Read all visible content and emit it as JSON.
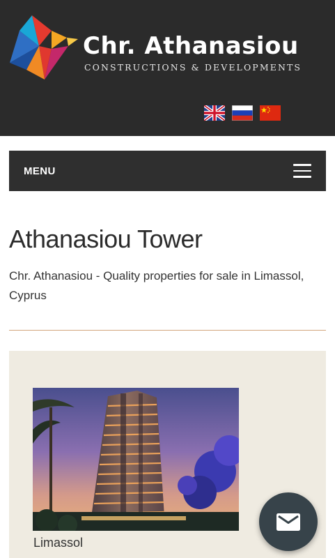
{
  "header": {
    "brand_name": "Chr. Athanasiou",
    "brand_tagline": "CONSTRUCTIONS & DEVELOPMENTS",
    "logo_icon": "bird-logo",
    "languages": [
      {
        "code": "en",
        "icon": "uk-flag-icon"
      },
      {
        "code": "ru",
        "icon": "russia-flag-icon"
      },
      {
        "code": "zh",
        "icon": "china-flag-icon"
      }
    ]
  },
  "nav": {
    "menu_label": "MENU",
    "menu_icon": "hamburger-icon"
  },
  "main": {
    "title": "Athanasiou Tower",
    "intro": "Chr. Athanasiou - Quality properties for sale in Limassol, Cyprus",
    "property": {
      "location": "Limassol",
      "image": "tower-photo"
    }
  },
  "fab": {
    "icon": "mail-icon"
  },
  "colors": {
    "header_bg": "#2b2b2b",
    "menu_bg": "#2f2f2f",
    "divider": "#d2a57d",
    "panel_bg": "#efebe1",
    "fab_bg": "#37434a"
  }
}
